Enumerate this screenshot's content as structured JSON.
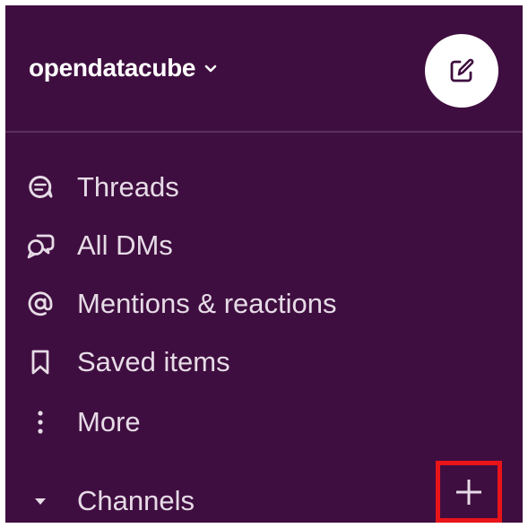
{
  "workspace": {
    "name": "opendatacube",
    "dropdown_icon": "chevron-down-icon",
    "compose_icon": "compose-icon"
  },
  "nav": {
    "items": [
      {
        "label": "Threads",
        "icon": "threads-icon"
      },
      {
        "label": "All DMs",
        "icon": "dms-icon"
      },
      {
        "label": "Mentions & reactions",
        "icon": "at-icon"
      },
      {
        "label": "Saved items",
        "icon": "bookmark-icon"
      },
      {
        "label": "More",
        "icon": "more-vertical-icon"
      }
    ]
  },
  "channels": {
    "label": "Channels",
    "toggle_icon": "caret-down-icon",
    "add_icon": "plus-icon"
  },
  "colors": {
    "sidebar_bg": "#3f0e40",
    "text": "#e6dbe6",
    "highlight_box": "#e8141a"
  }
}
